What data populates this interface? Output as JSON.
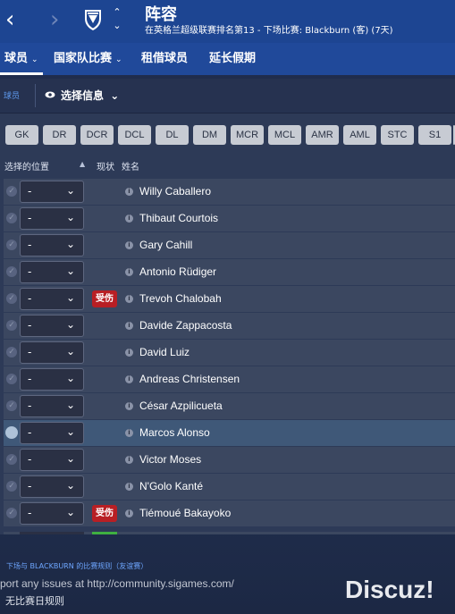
{
  "header": {
    "back_icon": "chevron-left-icon",
    "forward_icon": "chevron-right-icon",
    "crest_icon": "club-crest-icon",
    "title": "阵容",
    "subtitle": "在英格兰超级联赛排名第13 - 下场比赛: Blackburn (客) (7天)"
  },
  "menu": {
    "items": [
      {
        "label": "球员",
        "has_dropdown": true
      },
      {
        "label": "国家队比赛",
        "has_dropdown": true
      },
      {
        "label": "租借球员",
        "has_dropdown": false
      },
      {
        "label": "延长假期",
        "has_dropdown": false
      }
    ]
  },
  "subbar": {
    "tab_label": "球员",
    "view_label": "选择信息"
  },
  "position_buttons": [
    "GK",
    "DR",
    "DCR",
    "DCL",
    "DL",
    "DM",
    "MCR",
    "MCL",
    "AMR",
    "AML",
    "STC",
    "S1"
  ],
  "columns": {
    "position": "选择的位置",
    "status": "现状",
    "name": "姓名"
  },
  "players": [
    {
      "name": "Willy Caballero",
      "position": "-",
      "injury": ""
    },
    {
      "name": "Thibaut Courtois",
      "position": "-",
      "injury": ""
    },
    {
      "name": "Gary Cahill",
      "position": "-",
      "injury": ""
    },
    {
      "name": "Antonio Rüdiger",
      "position": "-",
      "injury": ""
    },
    {
      "name": "Trevoh Chalobah",
      "position": "-",
      "injury": "受伤"
    },
    {
      "name": "Davide Zappacosta",
      "position": "-",
      "injury": ""
    },
    {
      "name": "David Luiz",
      "position": "-",
      "injury": ""
    },
    {
      "name": "Andreas Christensen",
      "position": "-",
      "injury": ""
    },
    {
      "name": "César Azpilicueta",
      "position": "-",
      "injury": ""
    },
    {
      "name": "Marcos Alonso",
      "position": "-",
      "injury": "",
      "selected": true
    },
    {
      "name": "Victor Moses",
      "position": "-",
      "injury": ""
    },
    {
      "name": "N'Golo Kanté",
      "position": "-",
      "injury": ""
    },
    {
      "name": "Tiémoué Bakayoko",
      "position": "-",
      "injury": "受伤"
    }
  ],
  "footer": {
    "rules_link": "下场与 BLACKBURN 的比赛规则（友谊赛）",
    "report_text": "port any issues at http://community.sigames.com/",
    "no_rules": "无比赛日规则",
    "watermark": "Discuz!"
  },
  "colors": {
    "header_bg": "#1d4592",
    "injury_badge": "#b81f24",
    "link": "#6ea6ff"
  }
}
